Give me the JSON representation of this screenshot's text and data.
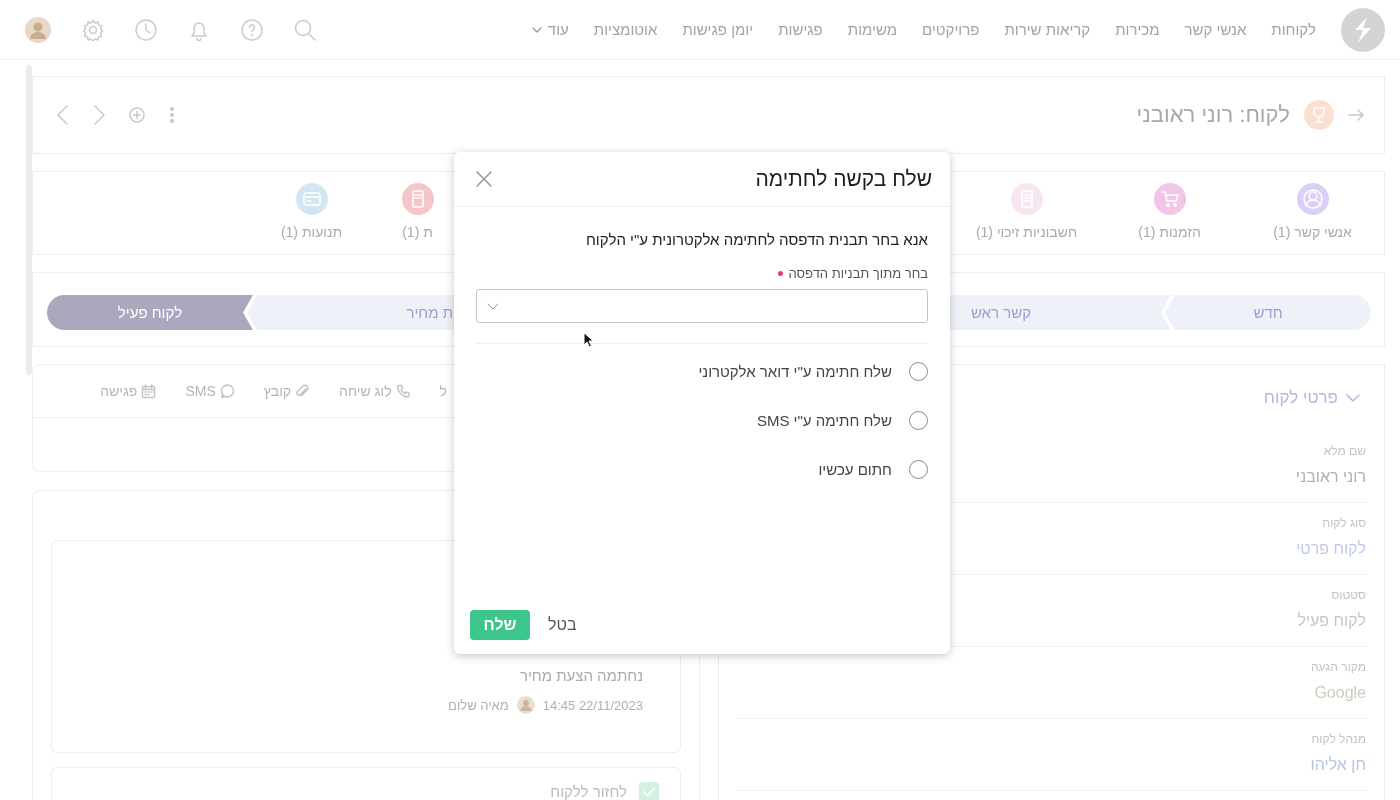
{
  "nav": {
    "items": [
      "לקוחות",
      "אנשי קשר",
      "מכירות",
      "קריאות שירות",
      "פרויקטים",
      "משימות",
      "פגישות",
      "יומן פגישות",
      "אוטומציות"
    ],
    "more": "עוד"
  },
  "record": {
    "title": "לקוח: רוני ראובני"
  },
  "stats": [
    {
      "label": "אנשי קשר (1)",
      "color": "#dccff7"
    },
    {
      "label": "הזמנות (1)",
      "color": "#f2c6e6"
    },
    {
      "label": "חשבוניות זיכוי (1)",
      "color": "#f7e6f0"
    },
    {
      "label": "ת (1)",
      "color": "#f5c5c9"
    },
    {
      "label": "תנועות (1)",
      "color": "#d3e7f3"
    }
  ],
  "pipeline": {
    "stages": [
      {
        "label": "חדש",
        "selected": false
      },
      {
        "label": "קשר ראש",
        "selected": false
      },
      {
        "label": "ת מחיר",
        "selected": false
      },
      {
        "label": "לקוח פעיל",
        "selected": true
      }
    ]
  },
  "activity": {
    "tabs": [
      "ל",
      "לוג שיחה",
      "קובץ",
      "SMS",
      "פגישה"
    ]
  },
  "timeline": {
    "entry": {
      "text": "נחתמה הצעת מחיר",
      "time": "22/11/2023 14:45",
      "user": "מאיה שלום"
    },
    "task": {
      "label": "לחזור ללקוח",
      "checked": true
    }
  },
  "details": {
    "title": "פרטי לקוח",
    "expanded": true,
    "fields": [
      {
        "label": "שם מלא",
        "value": "רוני ראובני",
        "color": "#b0b0b0"
      },
      {
        "label": "סוג לקוח",
        "value": "לקוח פרטי",
        "color": "#c2c8e8"
      },
      {
        "label": "סטטוס",
        "value": "לקוח פעיל",
        "color": "#c4c8bc"
      },
      {
        "label": "מקור הגעה",
        "value": "Google",
        "color": "#cfcdbb"
      },
      {
        "label": "מנהל לקוח",
        "value": "חן אליהו",
        "color": "#b8c3e6"
      }
    ]
  },
  "modal": {
    "title": "שלח בקשה לחתימה",
    "instruction": "אנא בחר תבנית הדפסה לחתימה אלקטרונית ע\"י הלקוח",
    "field": {
      "label": "בחר מתוך תבניות הדפסה",
      "required": true
    },
    "options": [
      {
        "label": "שלח חתימה ע\"י דואר אלקטרוני",
        "selected": false
      },
      {
        "label": "שלח חתימה ע\"י SMS",
        "selected": false
      },
      {
        "label": "חתום עכשיו",
        "selected": false
      }
    ],
    "send": "שלח",
    "cancel": "בטל"
  }
}
